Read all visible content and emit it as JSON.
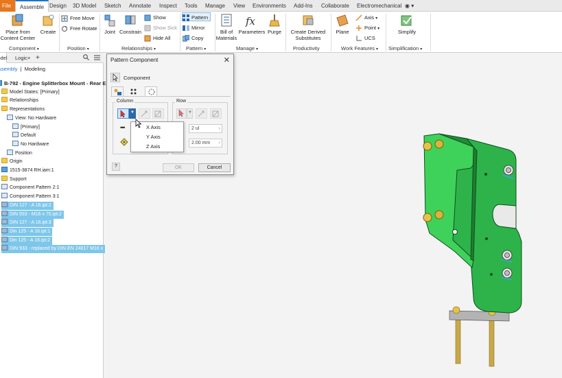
{
  "menu": {
    "items": [
      "File",
      "Assemble",
      "Design",
      "3D Model",
      "Sketch",
      "Annotate",
      "Inspect",
      "Tools",
      "Manage",
      "View",
      "Environments",
      "Add-Ins",
      "Collaborate",
      "Electromechanical"
    ],
    "active": "Assemble"
  },
  "ribbon": {
    "place_from_cc": "Place from\nContent Center",
    "create": "Create",
    "free_move": "Free Move",
    "free_rotate": "Free Rotate",
    "joint": "Joint",
    "constrain": "Constrain",
    "show": "Show",
    "show_sick": "Show Sick",
    "hide_all": "Hide All",
    "pattern": "Pattern",
    "mirror": "Mirror",
    "copy": "Copy",
    "bill_of_materials": "Bill of\nMaterials",
    "parameters": "Parameters",
    "purge": "Purge",
    "create_derived_substitutes": "Create Derived\nSubstitutes",
    "plane": "Plane",
    "axis": "Axis",
    "point": "Point",
    "ucs": "UCS",
    "simplify": "Simplify",
    "panels": {
      "component": "Component",
      "position": "Position",
      "relationships": "Relationships",
      "pattern": "Pattern",
      "manage": "Manage",
      "productivity": "Productivity",
      "work_features": "Work Features",
      "simplification": "Simplification"
    }
  },
  "browser": {
    "tabs": {
      "model": "Model",
      "logic": "Logic",
      "add": "+"
    },
    "crumb": {
      "assembly": "Assembly",
      "modeling": "Modeling"
    },
    "tree": [
      {
        "label": "B-792 - Engine Splitterbox Mount - Rear E",
        "indent": 0,
        "icon": "assembly",
        "selected": false,
        "title": true
      },
      {
        "label": "Model States: [Primary]",
        "indent": 1,
        "icon": "folder",
        "selected": false
      },
      {
        "label": "Relationships",
        "indent": 1,
        "icon": "folder",
        "selected": false
      },
      {
        "label": "Representations",
        "indent": 1,
        "icon": "folder",
        "selected": false
      },
      {
        "label": "View: No Hardware",
        "indent": 2,
        "icon": "view",
        "selected": false
      },
      {
        "label": "[Primary]",
        "indent": 3,
        "icon": "view",
        "selected": false
      },
      {
        "label": "Default",
        "indent": 3,
        "icon": "view",
        "selected": false
      },
      {
        "label": "No Hardware",
        "indent": 3,
        "icon": "view",
        "selected": false
      },
      {
        "label": "Position",
        "indent": 2,
        "icon": "view",
        "selected": false
      },
      {
        "label": "Origin",
        "indent": 1,
        "icon": "folder",
        "selected": false
      },
      {
        "label": "1515-3874 RH.iam:1",
        "indent": 1,
        "icon": "assembly",
        "selected": false
      },
      {
        "label": "Support",
        "indent": 1,
        "icon": "folder",
        "selected": false
      },
      {
        "label": "Component Pattern 2:1",
        "indent": 1,
        "icon": "pattern",
        "selected": false
      },
      {
        "label": "Component Pattern 3:1",
        "indent": 1,
        "icon": "pattern",
        "selected": false
      },
      {
        "label": "DIN 127 - A 16.ipt:2",
        "indent": 1,
        "icon": "part",
        "selected": true
      },
      {
        "label": "DIN 933 - M16 x 70.ipt:2",
        "indent": 1,
        "icon": "part",
        "selected": true
      },
      {
        "label": "DIN 127 - A 16.ipt:3",
        "indent": 1,
        "icon": "part",
        "selected": true
      },
      {
        "label": "Din 125 - A 16.ipt:1",
        "indent": 1,
        "icon": "part",
        "selected": true
      },
      {
        "label": "Din 125 - A 16.ipt:2",
        "indent": 1,
        "icon": "part",
        "selected": true
      },
      {
        "label": "DIN 933 - replaced by DIN EN 24017 M16 x",
        "indent": 1,
        "icon": "part",
        "selected": true
      }
    ]
  },
  "dialog": {
    "title": "Pattern Component",
    "component_label": "Component",
    "column_label": "Column",
    "row_label": "Row",
    "row_count": "2 ul",
    "row_spacing": "2.00 mm",
    "ok": "OK",
    "cancel": "Cancel",
    "help": "?",
    "close": "✕"
  },
  "dropdown": {
    "items": [
      "X Axis",
      "Y Axis",
      "Z Axis"
    ]
  },
  "colors": {
    "part_green": "#2db34a",
    "part_green_dark": "#1d7d31",
    "bolt_gold": "#d8b44a",
    "selection_blue": "#7ec6ea",
    "file_orange": "#e8761c"
  }
}
